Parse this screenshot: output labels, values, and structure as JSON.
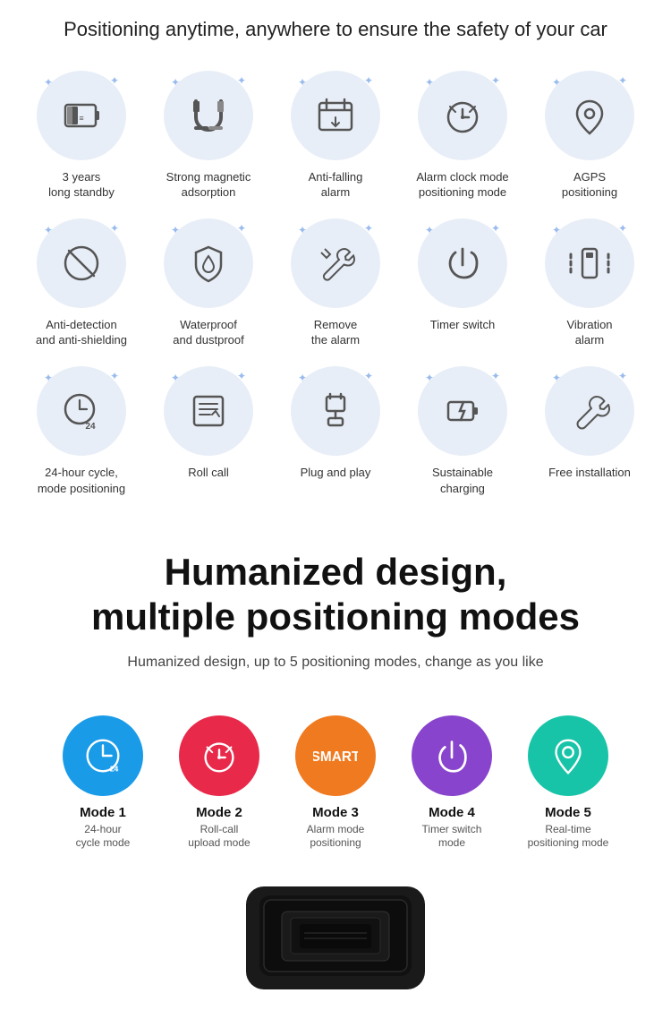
{
  "header": {
    "title": "Positioning anytime, anywhere to ensure the safety of your car"
  },
  "features": [
    {
      "id": "years-standby",
      "label": "3 years\nlong standby",
      "icon": "battery"
    },
    {
      "id": "magnetic",
      "label": "Strong magnetic\nadsorption",
      "icon": "magnet"
    },
    {
      "id": "anti-falling",
      "label": "Anti-falling\nalarm",
      "icon": "calendar"
    },
    {
      "id": "alarm-clock",
      "label": "Alarm clock mode\npositioning mode",
      "icon": "clock"
    },
    {
      "id": "agps",
      "label": "AGPS\npositioning",
      "icon": "pin"
    },
    {
      "id": "anti-detection",
      "label": "Anti-detection\nand anti-shielding",
      "icon": "no-signal"
    },
    {
      "id": "waterproof",
      "label": "Waterproof\nand dustproof",
      "icon": "shield-drop"
    },
    {
      "id": "remove-alarm",
      "label": "Remove\nthe alarm",
      "icon": "wrench"
    },
    {
      "id": "timer-switch",
      "label": "Timer switch",
      "icon": "power"
    },
    {
      "id": "vibration",
      "label": "Vibration\nalarm",
      "icon": "vibration"
    },
    {
      "id": "24hour",
      "label": "24-hour cycle,\nmode positioning",
      "icon": "clock24"
    },
    {
      "id": "roll-call",
      "label": "Roll call",
      "icon": "list"
    },
    {
      "id": "plug-play",
      "label": "Plug and play",
      "icon": "plug"
    },
    {
      "id": "sustainable",
      "label": "Sustainable\ncharging",
      "icon": "charging"
    },
    {
      "id": "free-install",
      "label": "Free installation",
      "icon": "wrench2"
    }
  ],
  "humanized": {
    "title": "Humanized design,\nmultiple positioning modes",
    "subtitle": "Humanized design, up to 5 positioning modes, change as you like"
  },
  "modes": [
    {
      "id": "mode1",
      "title": "Mode  1",
      "sub": "24-hour\ncycle mode",
      "color": "blue",
      "icon": "clock24"
    },
    {
      "id": "mode2",
      "title": "Mode  2",
      "sub": "Roll-call\nupload mode",
      "color": "red",
      "icon": "alarm"
    },
    {
      "id": "mode3",
      "title": "Mode  3",
      "sub": "Alarm mode\npositioning",
      "color": "orange",
      "icon": "smart"
    },
    {
      "id": "mode4",
      "title": "Mode  4",
      "sub": "Timer switch\nmode",
      "color": "purple",
      "icon": "power"
    },
    {
      "id": "mode5",
      "title": "Mode  5",
      "sub": "Real-time\npositioning mode",
      "color": "teal",
      "icon": "pin"
    }
  ]
}
